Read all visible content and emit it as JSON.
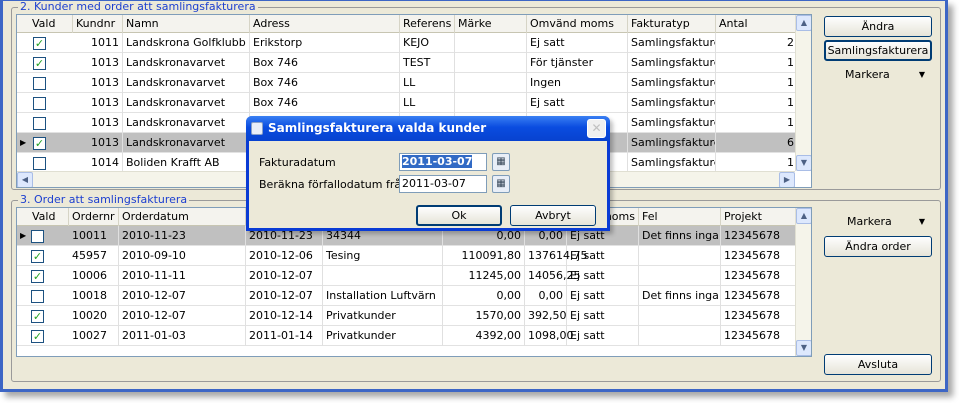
{
  "customers_group": {
    "title": "2. Kunder med order att samlingsfakturera",
    "columns": [
      "Vald",
      "Kundnr",
      "Namn",
      "Adress",
      "Referens",
      "Märke",
      "Omvänd moms",
      "Fakturatyp",
      "Antal"
    ],
    "rows": [
      {
        "vald": true,
        "kundnr": "1011",
        "namn": "Landskrona Golfklubb",
        "adress": "Erikstorp",
        "referens": "KEJO",
        "marke": "",
        "omvand": "Ej satt",
        "typ": "Samlingsfakturera",
        "antal": "2"
      },
      {
        "vald": true,
        "kundnr": "1013",
        "namn": "Landskronavarvet",
        "adress": "Box 746",
        "referens": "TEST",
        "marke": "",
        "omvand": "För tjänster",
        "typ": "Samlingsfakturera",
        "antal": "1"
      },
      {
        "vald": false,
        "kundnr": "1013",
        "namn": "Landskronavarvet",
        "adress": "Box 746",
        "referens": "LL",
        "marke": "",
        "omvand": "Ingen",
        "typ": "Samlingsfakturera",
        "antal": "1"
      },
      {
        "vald": false,
        "kundnr": "1013",
        "namn": "Landskronavarvet",
        "adress": "Box 746",
        "referens": "LL",
        "marke": "",
        "omvand": "Ej satt",
        "typ": "Samlingsfakturera",
        "antal": "1"
      },
      {
        "vald": false,
        "kundnr": "1013",
        "namn": "Landskronavarvet",
        "adress": "",
        "referens": "",
        "marke": "",
        "omvand": "",
        "typ": "Samlingsfakturera",
        "antal": "1"
      },
      {
        "vald": true,
        "kundnr": "1013",
        "namn": "Landskronavarvet",
        "adress": "",
        "referens": "",
        "marke": "",
        "omvand": "",
        "typ": "Samlingsfakturera",
        "antal": "6"
      },
      {
        "vald": false,
        "kundnr": "1014",
        "namn": "Boliden Krafft AB",
        "adress": "",
        "referens": "",
        "marke": "",
        "omvand": "",
        "typ": "Samlingsfakturera",
        "antal": "1"
      }
    ]
  },
  "customer_buttons": {
    "andra": "Ändra",
    "samlingsfakturera": "Samlingsfakturera",
    "markera": "Markera"
  },
  "orders_group": {
    "title": "3. Order att samlingsfakturera",
    "columns": [
      "Vald",
      "Ordernr",
      "Orderdatum",
      "",
      "",
      "",
      "",
      "moms",
      "Fel",
      "Projekt"
    ],
    "rows": [
      {
        "vald": false,
        "ordernr": "10011",
        "orderdatum": "2010-11-23",
        "datum2": "2010-11-23",
        "text": "34344",
        "belopp1": "0,00",
        "belopp2": "0,00",
        "moms": "Ej satt",
        "fel": "Det finns inga ra",
        "projekt": "12345678"
      },
      {
        "vald": true,
        "ordernr": "45957",
        "orderdatum": "2010-09-10",
        "datum2": "2010-12-06",
        "text": "Tesing",
        "belopp1": "110091,80",
        "belopp2": "137614,75",
        "moms": "Ej satt",
        "fel": "",
        "projekt": "12345678"
      },
      {
        "vald": true,
        "ordernr": "10006",
        "orderdatum": "2010-11-11",
        "datum2": "2010-12-07",
        "text": "",
        "belopp1": "11245,00",
        "belopp2": "14056,25",
        "moms": "Ej satt",
        "fel": "",
        "projekt": "12345678"
      },
      {
        "vald": false,
        "ordernr": "10018",
        "orderdatum": "2010-12-07",
        "datum2": "2010-12-07",
        "text": "Installation Luftvärn",
        "belopp1": "0,00",
        "belopp2": "0,00",
        "moms": "Ej satt",
        "fel": "Det finns inga ra",
        "projekt": "12345678"
      },
      {
        "vald": true,
        "ordernr": "10020",
        "orderdatum": "2010-12-07",
        "datum2": "2010-12-14",
        "text": "Privatkunder",
        "belopp1": "1570,00",
        "belopp2": "392,50",
        "moms": "Ej satt",
        "fel": "",
        "projekt": "12345678"
      },
      {
        "vald": true,
        "ordernr": "10027",
        "orderdatum": "2011-01-03",
        "datum2": "2011-01-14",
        "text": "Privatkunder",
        "belopp1": "4392,00",
        "belopp2": "1098,00",
        "moms": "Ej satt",
        "fel": "",
        "projekt": "12345678"
      }
    ]
  },
  "order_buttons": {
    "markera": "Markera",
    "andra_order": "Ändra order",
    "avsluta": "Avsluta"
  },
  "dialog": {
    "title": "Samlingsfakturera valda kunder",
    "fakturadatum_label": "Fakturadatum",
    "fakturadatum_value": "2011-03-07",
    "forfallodatum_label": "Beräkna förfallodatum från",
    "forfallodatum_value": "2011-03-07",
    "ok_label": "Ok",
    "avbryt_label": "Avbryt",
    "close_glyph": "✕"
  },
  "icons": {
    "checkmark": "✓",
    "row_pointer": "▶",
    "scroll_up": "▲",
    "scroll_down": "▼",
    "scroll_left": "◀",
    "scroll_right": "▶",
    "dropdown": "▼",
    "calendar": "▦"
  }
}
